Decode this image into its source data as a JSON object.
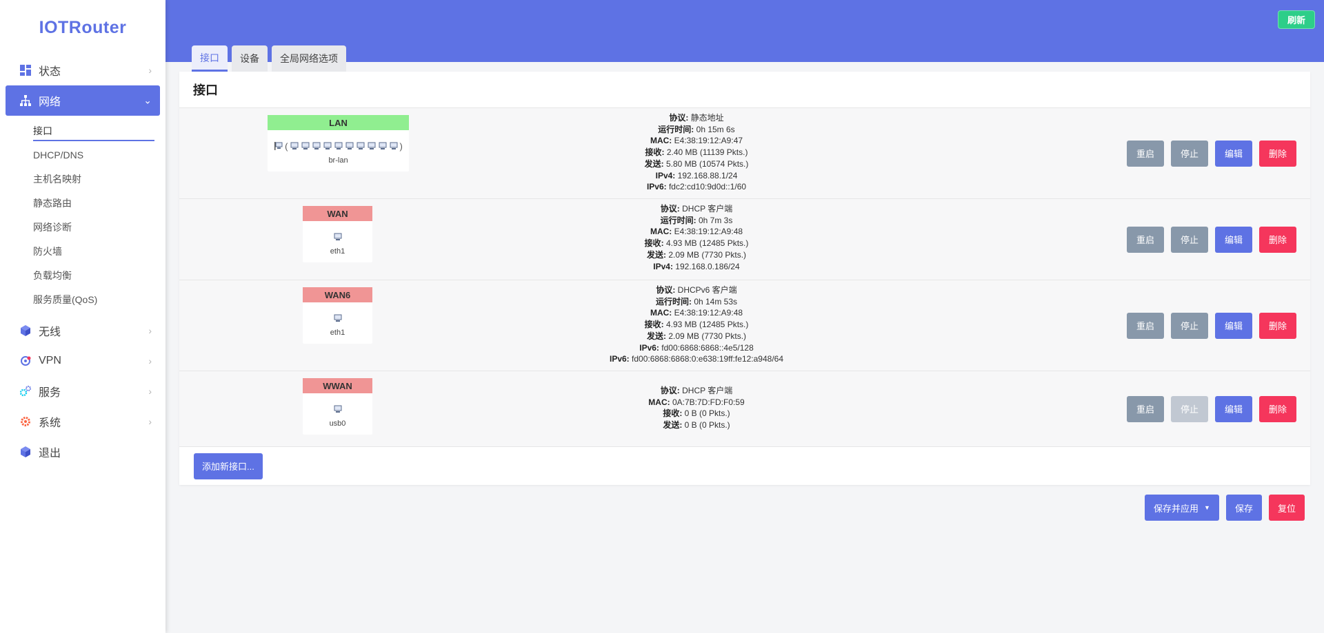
{
  "brand": "IOTRouter",
  "header": {
    "refresh_label": "刷新"
  },
  "sidebar": {
    "items": [
      {
        "label": "状态",
        "icon": "dashboard-icon"
      },
      {
        "label": "网络",
        "icon": "network-icon",
        "active": true
      },
      {
        "label": "无线",
        "icon": "cube-icon"
      },
      {
        "label": "VPN",
        "icon": "vpn-icon"
      },
      {
        "label": "服务",
        "icon": "gears-icon"
      },
      {
        "label": "系统",
        "icon": "gear-icon"
      },
      {
        "label": "退出",
        "icon": "cube-icon"
      }
    ],
    "submenu": [
      "接口",
      "DHCP/DNS",
      "主机名映射",
      "静态路由",
      "网络诊断",
      "防火墙",
      "负载均衡",
      "服务质量(QoS)"
    ]
  },
  "tabs": [
    "接口",
    "设备",
    "全局网络选项"
  ],
  "panel_title": "接口",
  "interfaces": [
    {
      "name": "LAN",
      "device": "br-lan",
      "info": [
        [
          "协议:",
          "静态地址"
        ],
        [
          "运行时间:",
          "0h 15m 6s"
        ],
        [
          "MAC:",
          "E4:38:19:12:A9:47"
        ],
        [
          "接收:",
          "2.40 MB (11139 Pkts.)"
        ],
        [
          "发送:",
          "5.80 MB (10574 Pkts.)"
        ],
        [
          "IPv4:",
          "192.168.88.1/24"
        ],
        [
          "IPv6:",
          "fdc2:cd10:9d0d::1/60"
        ]
      ]
    },
    {
      "name": "WAN",
      "device": "eth1",
      "info": [
        [
          "协议:",
          "DHCP 客户端"
        ],
        [
          "运行时间:",
          "0h 7m 3s"
        ],
        [
          "MAC:",
          "E4:38:19:12:A9:48"
        ],
        [
          "接收:",
          "4.93 MB (12485 Pkts.)"
        ],
        [
          "发送:",
          "2.09 MB (7730 Pkts.)"
        ],
        [
          "IPv4:",
          "192.168.0.186/24"
        ]
      ]
    },
    {
      "name": "WAN6",
      "device": "eth1",
      "info": [
        [
          "协议:",
          "DHCPv6 客户端"
        ],
        [
          "运行时间:",
          "0h 14m 53s"
        ],
        [
          "MAC:",
          "E4:38:19:12:A9:48"
        ],
        [
          "接收:",
          "4.93 MB (12485 Pkts.)"
        ],
        [
          "发送:",
          "2.09 MB (7730 Pkts.)"
        ],
        [
          "IPv6:",
          "fd00:6868:6868::4e5/128"
        ],
        [
          "IPv6:",
          "fd00:6868:6868:0:e638:19ff:fe12:a948/64"
        ]
      ]
    },
    {
      "name": "WWAN",
      "device": "usb0",
      "info": [
        [
          "协议:",
          "DHCP 客户端"
        ],
        [
          "MAC:",
          "0A:7B:7D:FD:F0:59"
        ],
        [
          "接收:",
          "0 B (0 Pkts.)"
        ],
        [
          "发送:",
          "0 B (0 Pkts.)"
        ]
      ]
    }
  ],
  "row_buttons": {
    "restart": "重启",
    "stop": "停止",
    "edit": "编辑",
    "delete": "删除"
  },
  "add_button": "添加新接口...",
  "footer": {
    "save_apply": "保存并应用",
    "save": "保存",
    "reset": "复位"
  },
  "colors": {
    "accent": "#5e72e4",
    "success": "#2dce89",
    "danger": "#f5365c",
    "neutral": "#8898aa"
  }
}
